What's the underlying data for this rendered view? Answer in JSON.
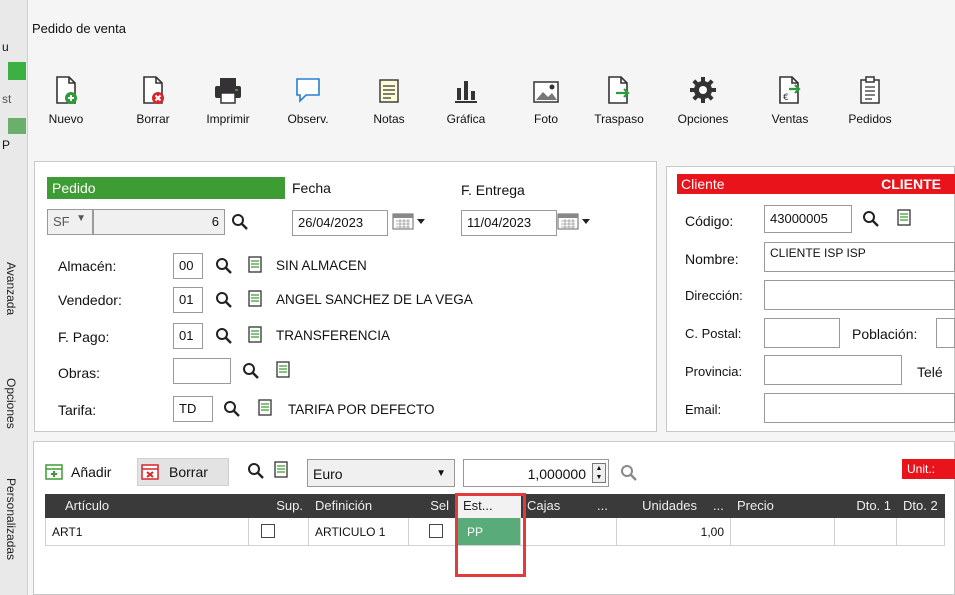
{
  "window": {
    "title": "Pedido de venta"
  },
  "left_strip": {
    "fragments": [
      "u",
      "st",
      "P"
    ],
    "tabs": [
      "Avanzada",
      "Opciones",
      "Personalizadas"
    ]
  },
  "toolbar": {
    "items": [
      {
        "label": "Nuevo",
        "icon": "new-doc-icon"
      },
      {
        "label": "Borrar",
        "icon": "delete-doc-icon"
      },
      {
        "label": "Imprimir",
        "icon": "printer-icon"
      },
      {
        "label": "Observ.",
        "icon": "comment-icon"
      },
      {
        "label": "Notas",
        "icon": "notes-icon"
      },
      {
        "label": "Gráfica",
        "icon": "bar-chart-icon"
      },
      {
        "label": "Foto",
        "icon": "image-icon"
      },
      {
        "label": "Traspaso",
        "icon": "transfer-icon"
      },
      {
        "label": "Opciones",
        "icon": "gear-icon"
      },
      {
        "label": "Ventas",
        "icon": "sales-icon"
      },
      {
        "label": "Pedidos",
        "icon": "clipboard-icon"
      }
    ]
  },
  "pedido": {
    "header": "Pedido",
    "serie": "SF",
    "numero": "6",
    "fecha_label": "Fecha",
    "fecha": "26/04/2023",
    "entrega_label": "F. Entrega",
    "entrega": "11/04/2023",
    "almacen_label": "Almacén:",
    "almacen_code": "00",
    "almacen_name": "SIN ALMACEN",
    "vendedor_label": "Vendedor:",
    "vendedor_code": "01",
    "vendedor_name": "ANGEL SANCHEZ DE LA VEGA",
    "pago_label": "F. Pago:",
    "pago_code": "01",
    "pago_name": "TRANSFERENCIA",
    "obras_label": "Obras:",
    "obras_code": "",
    "tarifa_label": "Tarifa:",
    "tarifa_code": "TD",
    "tarifa_name": "TARIFA POR DEFECTO"
  },
  "cliente": {
    "header": "Cliente",
    "header_right": "CLIENTE",
    "codigo_label": "Código:",
    "codigo": "43000005",
    "nombre_label": "Nombre:",
    "nombre": "CLIENTE ISP ISP",
    "direccion_label": "Dirección:",
    "postal_label": "C. Postal:",
    "poblacion_label": "Población:",
    "provincia_label": "Provincia:",
    "telefono_label": "Telé",
    "email_label": "Email:"
  },
  "lines_toolbar": {
    "add_label": "Añadir",
    "delete_label": "Borrar",
    "currency": "Euro",
    "rate": "1,000000",
    "unit_badge": "Unit.:"
  },
  "table": {
    "headers": [
      "Artículo",
      "Sup.",
      "Definición",
      "Sel",
      "Est...",
      "Cajas",
      "...",
      "Unidades",
      "...",
      "Precio",
      "Dto. 1",
      "Dto. 2"
    ],
    "rows": [
      {
        "articulo": "ART1",
        "definicion": "ARTICULO 1",
        "estado": "PP",
        "unidades": "1,00"
      }
    ]
  },
  "colors": {
    "green": "#3e9c35",
    "red": "#e8131b",
    "state_green": "#5aab7a",
    "highlight": "#e33a3a"
  }
}
